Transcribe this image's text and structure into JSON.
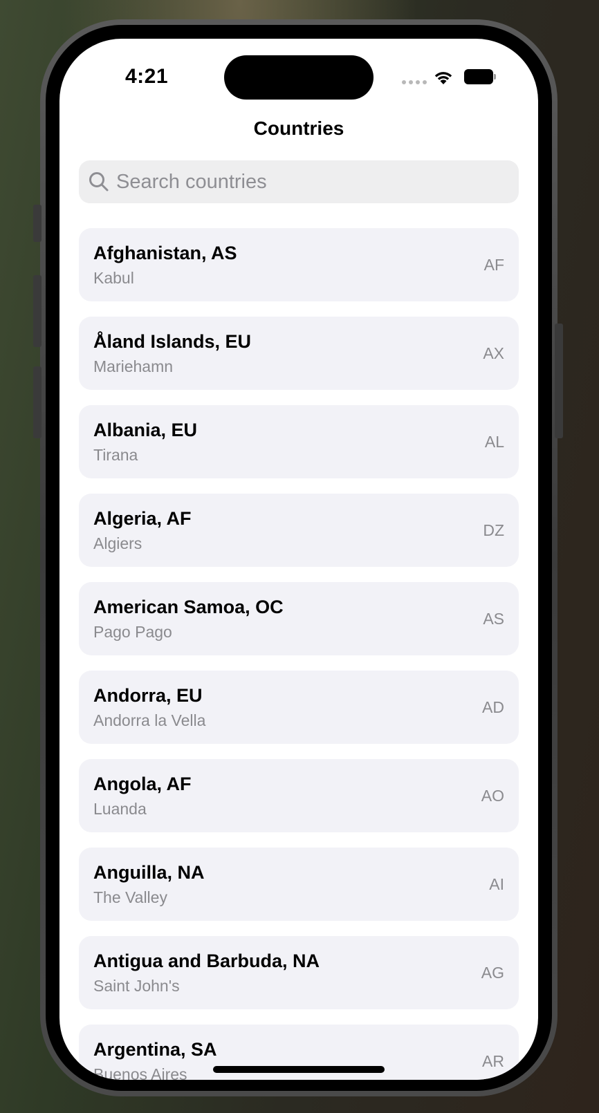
{
  "status_bar": {
    "time": "4:21",
    "signal_icon": "cellular-signal-icon",
    "wifi_icon": "wifi-icon",
    "battery_icon": "battery-icon"
  },
  "nav": {
    "title": "Countries"
  },
  "search": {
    "icon": "search-icon",
    "placeholder": "Search countries",
    "value": ""
  },
  "countries": [
    {
      "name": "Afghanistan, AS",
      "capital": "Kabul",
      "code": "AF"
    },
    {
      "name": "Åland Islands, EU",
      "capital": "Mariehamn",
      "code": "AX"
    },
    {
      "name": "Albania, EU",
      "capital": "Tirana",
      "code": "AL"
    },
    {
      "name": "Algeria, AF",
      "capital": "Algiers",
      "code": "DZ"
    },
    {
      "name": "American Samoa, OC",
      "capital": "Pago Pago",
      "code": "AS"
    },
    {
      "name": "Andorra, EU",
      "capital": "Andorra la Vella",
      "code": "AD"
    },
    {
      "name": "Angola, AF",
      "capital": "Luanda",
      "code": "AO"
    },
    {
      "name": "Anguilla, NA",
      "capital": "The Valley",
      "code": "AI"
    },
    {
      "name": "Antigua and Barbuda, NA",
      "capital": "Saint John's",
      "code": "AG"
    },
    {
      "name": "Argentina, SA",
      "capital": "Buenos Aires",
      "code": "AR"
    }
  ],
  "colors": {
    "row_background": "#f2f2f7",
    "secondary_text": "#8a8a8e",
    "search_background": "#eeeeef"
  }
}
